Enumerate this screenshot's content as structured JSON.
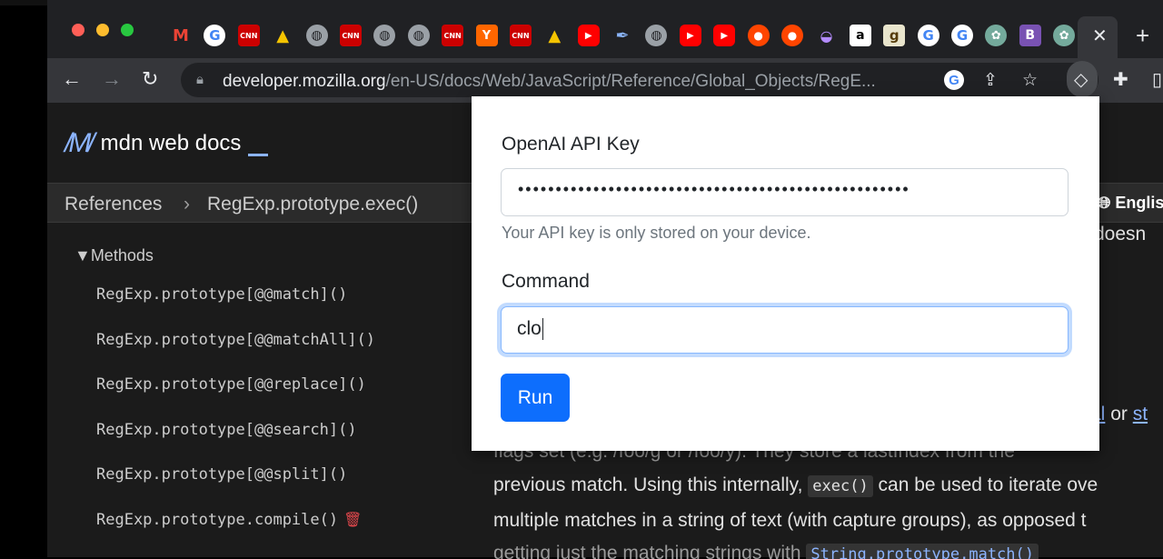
{
  "browser": {
    "tab_icons": [
      {
        "name": "gmail-icon",
        "glyph": "M",
        "cls": "ti-gmail"
      },
      {
        "name": "google-icon",
        "glyph": "G",
        "cls": "ti-g"
      },
      {
        "name": "cnn-icon",
        "glyph": "CNN",
        "cls": "ti-cnn"
      },
      {
        "name": "warning-icon",
        "glyph": "▲",
        "cls": "ti-warn"
      },
      {
        "name": "globe-icon",
        "glyph": "◍",
        "cls": "ti-globe"
      },
      {
        "name": "cnn-icon",
        "glyph": "CNN",
        "cls": "ti-cnn"
      },
      {
        "name": "globe-icon",
        "glyph": "◍",
        "cls": "ti-globe"
      },
      {
        "name": "globe-icon",
        "glyph": "◍",
        "cls": "ti-globe"
      },
      {
        "name": "cnn-icon",
        "glyph": "CNN",
        "cls": "ti-cnn"
      },
      {
        "name": "hacker-news-icon",
        "glyph": "Y",
        "cls": "ti-y"
      },
      {
        "name": "cnn-icon",
        "glyph": "CNN",
        "cls": "ti-cnn"
      },
      {
        "name": "warning-icon",
        "glyph": "▲",
        "cls": "ti-warn"
      },
      {
        "name": "youtube-icon",
        "glyph": "▶",
        "cls": "ti-yt"
      },
      {
        "name": "feather-icon",
        "glyph": "✒",
        "cls": "ti-feather"
      },
      {
        "name": "globe-icon",
        "glyph": "◍",
        "cls": "ti-globe"
      },
      {
        "name": "youtube-icon",
        "glyph": "▶",
        "cls": "ti-yt"
      },
      {
        "name": "youtube-icon",
        "glyph": "▶",
        "cls": "ti-yt"
      },
      {
        "name": "reddit-icon",
        "glyph": "●",
        "cls": "ti-reddit"
      },
      {
        "name": "reddit-icon",
        "glyph": "●",
        "cls": "ti-reddit"
      },
      {
        "name": "blob-icon",
        "glyph": "◒",
        "cls": "ti-blob"
      },
      {
        "name": "amazon-icon",
        "glyph": "a",
        "cls": "ti-amazon"
      },
      {
        "name": "goodreads-icon",
        "glyph": "g",
        "cls": "ti-goodreads"
      },
      {
        "name": "google-icon",
        "glyph": "G",
        "cls": "ti-g"
      },
      {
        "name": "google-icon",
        "glyph": "G",
        "cls": "ti-g"
      },
      {
        "name": "chatgpt-icon",
        "glyph": "✿",
        "cls": "ti-gpt"
      },
      {
        "name": "bootstrap-icon",
        "glyph": "B",
        "cls": "ti-b"
      },
      {
        "name": "chatgpt-icon",
        "glyph": "✿",
        "cls": "ti-gpt"
      }
    ],
    "url_host": "developer.mozilla.org",
    "url_path": "/en-US/docs/Web/JavaScript/Reference/Global_Objects/RegE..."
  },
  "mdn": {
    "logo_text": "mdn web docs",
    "breadcrumb": {
      "first": "References",
      "separator": "›",
      "current": "RegExp.prototype.exec()"
    },
    "lang": "English",
    "sidebar": {
      "heading": "▼Methods",
      "items": [
        "RegExp.prototype[@@match]()",
        "RegExp.prototype[@@matchAll]()",
        "RegExp.prototype[@@replace]()",
        "RegExp.prototype[@@search]()",
        "RegExp.prototype[@@split]()",
        "RegExp.prototype.compile()"
      ]
    },
    "content": {
      "doesn": "doesn",
      "or_link_1": "al",
      "or_word": "or",
      "or_link_2": "st",
      "flags_line": "flags set (e.g. /foo/g or /foo/y). They store a lastIndex from the",
      "prev_1": "previous match. Using this internally,",
      "prev_code": "exec()",
      "prev_2": "can be used to iterate ove",
      "multi_line": "multiple matches in a string of text (with capture groups), as opposed t",
      "getting_1": "getting just the matching strings with",
      "getting_code": "String.prototype.match()"
    }
  },
  "popup": {
    "api_label": "OpenAI API Key",
    "api_value": "••••••••••••••••••••••••••••••••••••••••••••••••••••",
    "api_help": "Your API key is only stored on your device.",
    "command_label": "Command",
    "command_value": "clo",
    "run_label": "Run"
  },
  "colors": {
    "accent": "#0d6efd",
    "mdn_blue": "#8cb4ff"
  }
}
